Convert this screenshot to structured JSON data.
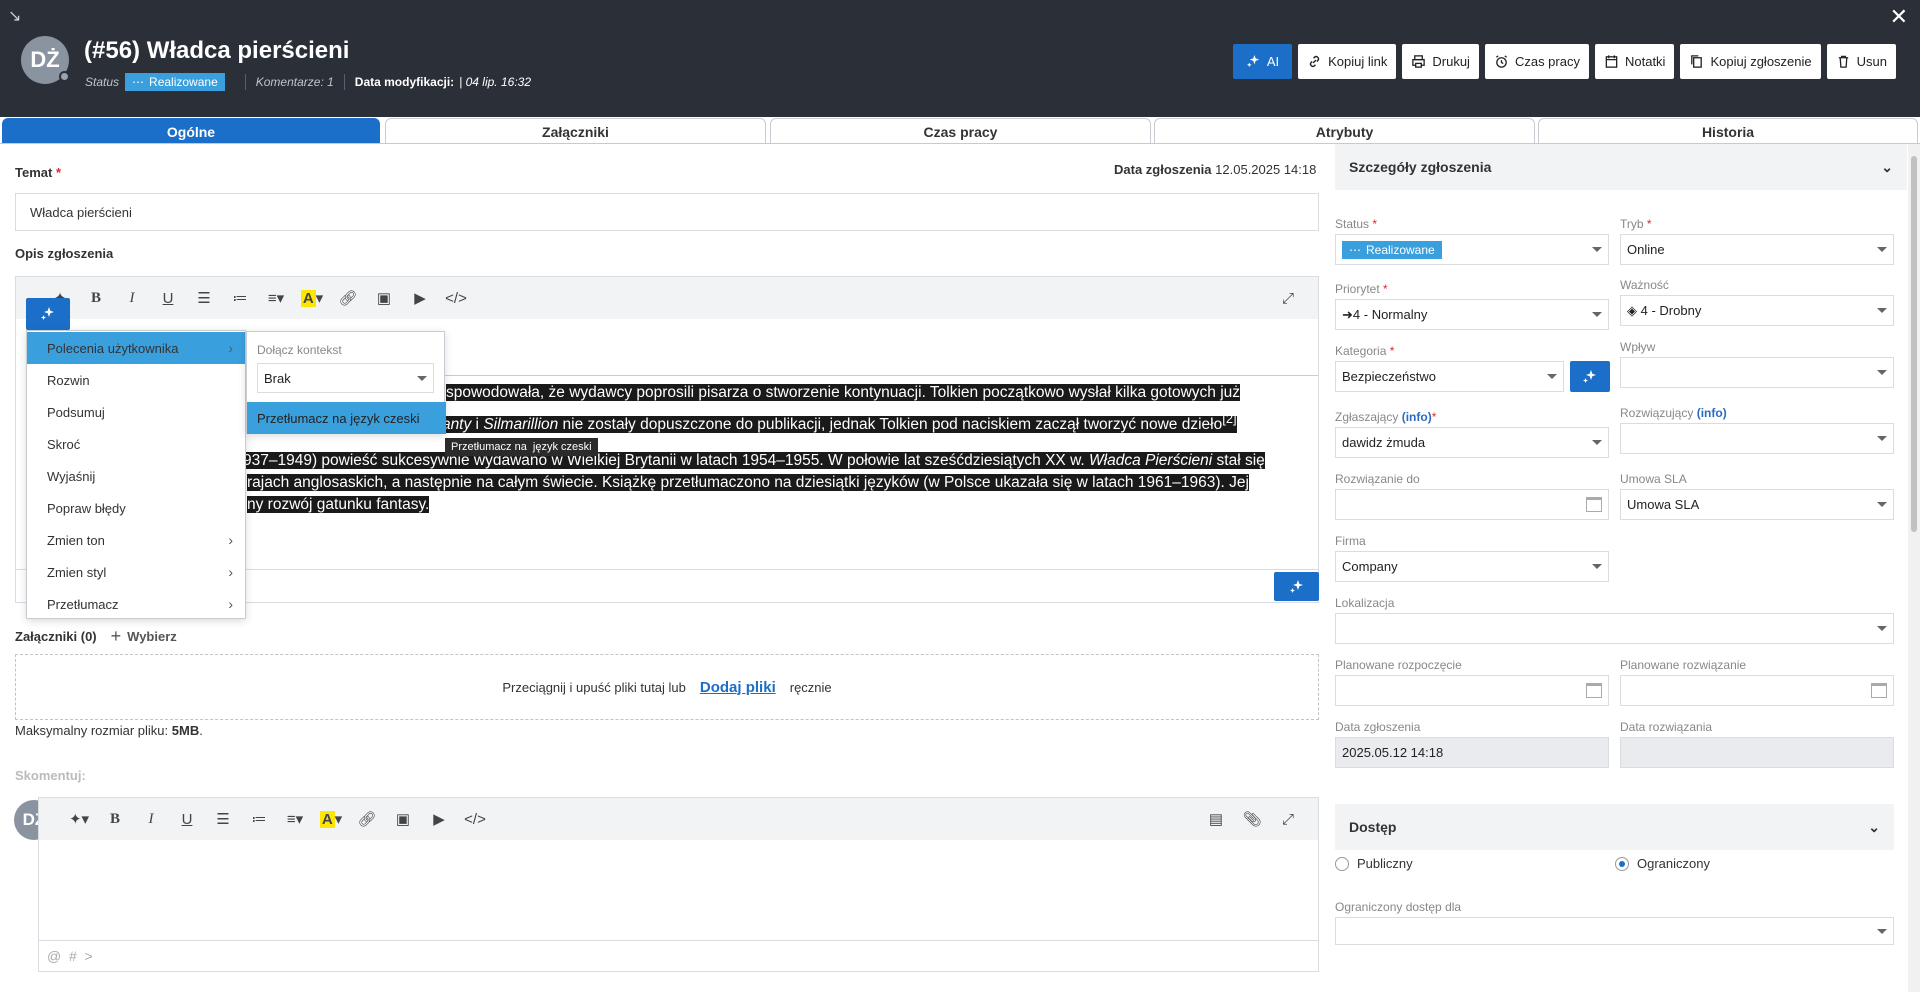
{
  "header": {
    "avatar_initials": "DŻ",
    "title": "(#56) Władca pierścieni",
    "status_label": "Status",
    "status_value": "Realizowane",
    "comments": "Komentarze: 1",
    "modified_label": "Data modyfikacji:",
    "modified_value": "| 04 lip. 16:32",
    "buttons": {
      "ai": "AI",
      "copy_link": "Kopiuj link",
      "print": "Drukuj",
      "work_time": "Czas pracy",
      "notes": "Notatki",
      "copy_ticket": "Kopiuj zgłoszenie",
      "delete": "Usun"
    }
  },
  "tabs": [
    "Ogólne",
    "Załączniki",
    "Czas pracy",
    "Atrybuty",
    "Historia"
  ],
  "main": {
    "subject_label": "Temat",
    "subject_value": "Władca pierścieni",
    "report_date_label": "Data zgłoszenia",
    "report_date_value": "12.05.2025 14:18",
    "description_label": "Opis zgłoszenia",
    "text_lines": [
      {
        "a": "spowodowała, że wydawcy poprosili pisarza o stworzenie kontynuacji. Tolkien początkowo wysłał kilka gotowych już",
        "b": "",
        "c": ""
      },
      {
        "a": "zikanty",
        "b": " i ",
        "c": "Silmarillion",
        "d": " nie zostały dopuszczone do publikacji, jednak Tolkien pod naciskiem zaczął tworzyć nowe dzieło",
        "e": "[2]"
      },
      {
        "a": "937–1949) powieść sukcesywnie wydawano w Wielkiej Brytanii w latach 1954–1955. W połowie lat sześćdziesiątych XX w. ",
        "b": "Władca Pierścieni",
        "c": " stał się"
      },
      {
        "a": "rajach anglosaskich, a następnie na całym świecie. Książkę przetłumaczono na dziesiątki języków (w Polsce ukazała się w latach 1961–1963). Jej"
      },
      {
        "a": "ny rozwój gatunku fantasy."
      }
    ],
    "ai_menu": [
      {
        "label": "Polecenia użytkownika",
        "sub": true
      },
      {
        "label": "Rozwin",
        "sub": false
      },
      {
        "label": "Podsumuj",
        "sub": false
      },
      {
        "label": "Skroć",
        "sub": false
      },
      {
        "label": "Wyjaśnij",
        "sub": false
      },
      {
        "label": "Popraw błędy",
        "sub": false
      },
      {
        "label": "Zmien ton",
        "sub": true
      },
      {
        "label": "Zmien styl",
        "sub": true
      },
      {
        "label": "Przetłumacz",
        "sub": true
      }
    ],
    "submenu": {
      "context_label": "Dołącz kontekst",
      "context_value": "Brak",
      "item": "Przetłumacz na język czeski",
      "tooltip": "Przetłumacz na  język czeski"
    },
    "attachments_label": "Załączniki (0)",
    "choose_label": "Wybierz",
    "drop_text": "Przeciągnij i upuść pliki tutaj lub",
    "drop_link": "Dodaj pliki",
    "drop_tail": "ręcznie",
    "max_size_label": "Maksymalny rozmiar pliku:",
    "max_size_value": "5MB",
    "comment_label": "Skomentuj:",
    "comment_avatar": "DŻ",
    "mention_hint": "@  #  >"
  },
  "details": {
    "title": "Szczegóły zgłoszenia",
    "status_label": "Status",
    "status_value": "Realizowane",
    "mode_label": "Tryb",
    "mode_value": "Online",
    "priority_label": "Priorytet",
    "priority_value": "4 - Normalny",
    "importance_label": "Ważność",
    "importance_value": "4 - Drobny",
    "category_label": "Kategoria",
    "category_value": "Bezpieczeństwo",
    "impact_label": "Wpływ",
    "reporter_label": "Zgłaszający",
    "reporter_info": "(info)",
    "reporter_value": "dawidz żmuda",
    "resolver_label": "Rozwiązujący",
    "resolver_info": "(info)",
    "resolve_by_label": "Rozwiązanie do",
    "sla_label": "Umowa SLA",
    "sla_value": "Umowa SLA",
    "company_label": "Firma",
    "company_value": "Company",
    "location_label": "Lokalizacja",
    "planned_start_label": "Planowane rozpoczęcie",
    "planned_resolve_label": "Planowane rozwiązanie",
    "report_date_label": "Data zgłoszenia",
    "report_date_value": "2025.05.12 14:18",
    "resolve_date_label": "Data rozwiązania"
  },
  "access": {
    "title": "Dostęp",
    "public": "Publiczny",
    "restricted": "Ograniczony",
    "restricted_for": "Ograniczony dostęp dla"
  },
  "colors": {
    "accent": "#1c6fc9",
    "status": "#3aa0dd",
    "header": "#2b3038"
  }
}
